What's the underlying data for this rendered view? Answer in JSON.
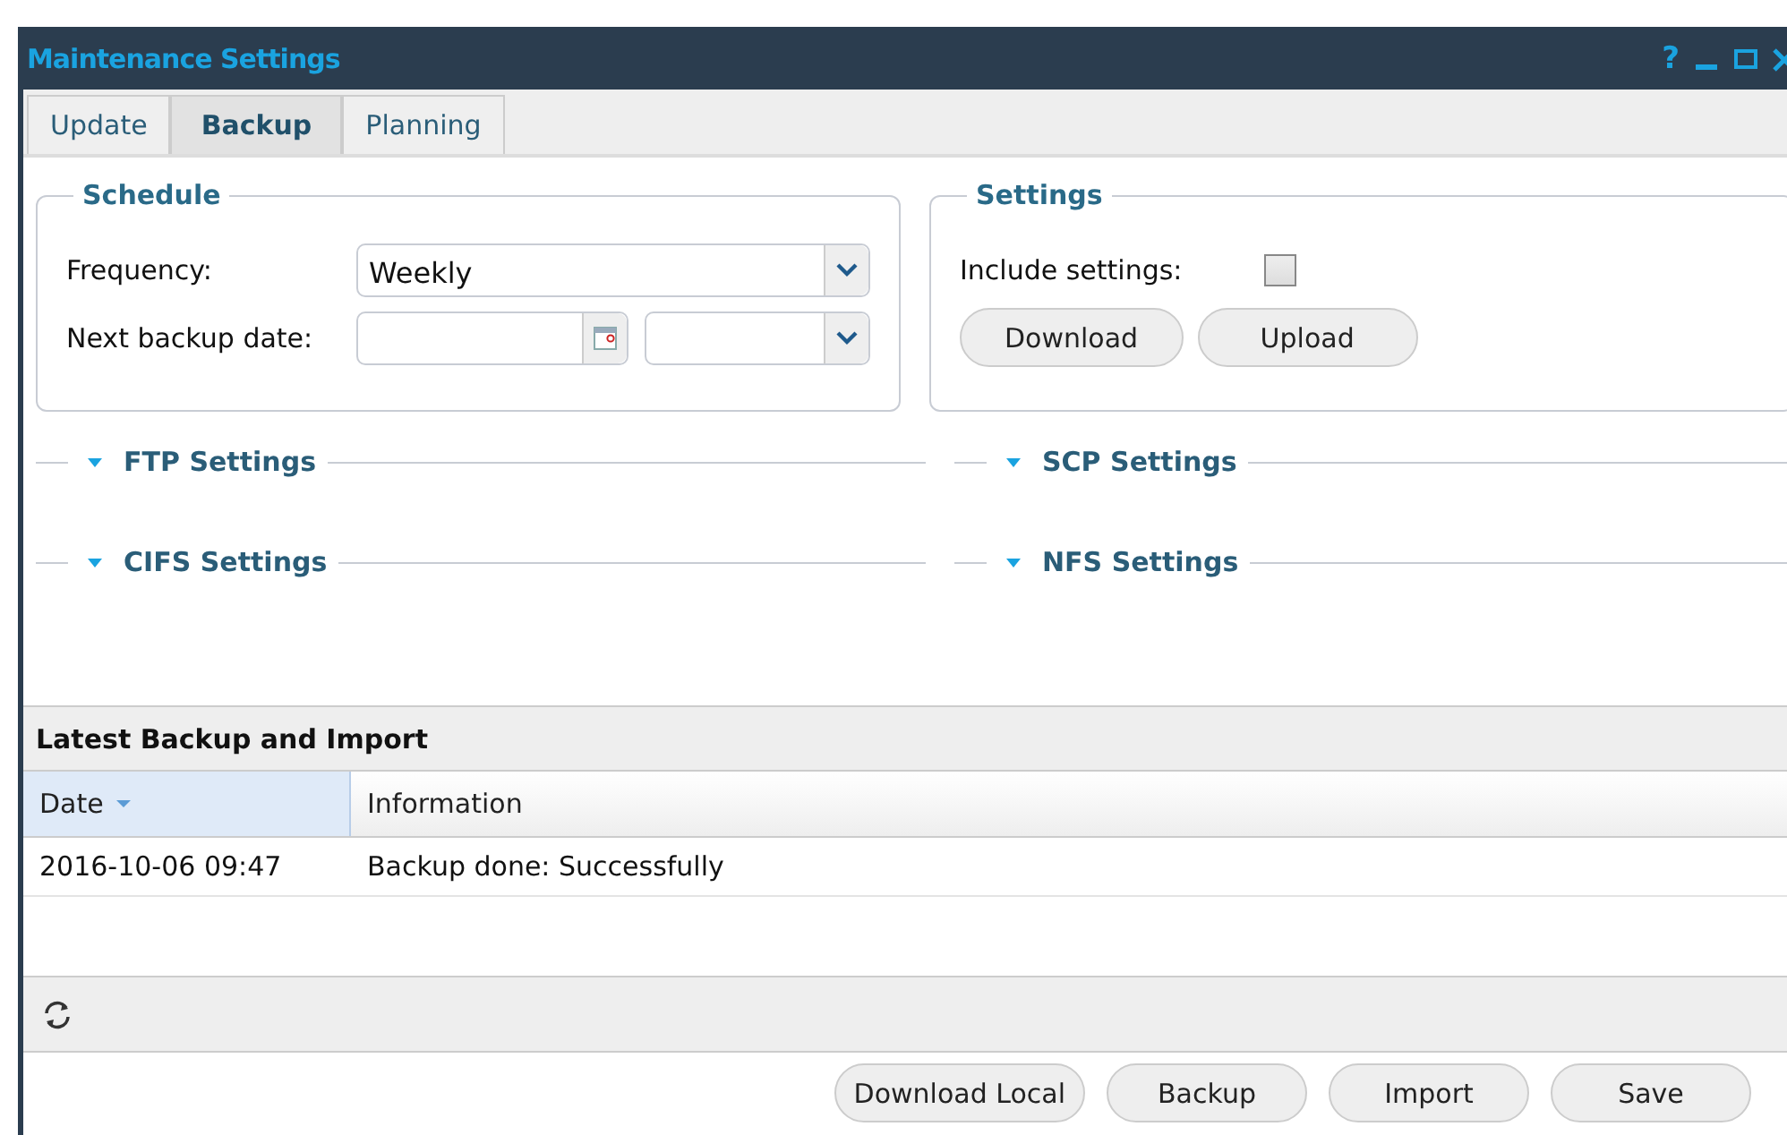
{
  "window": {
    "title": "Maintenance Settings",
    "controls": [
      "?"
    ]
  },
  "tabs": [
    {
      "label": "Update",
      "selected": false
    },
    {
      "label": "Backup",
      "selected": true
    },
    {
      "label": "Planning",
      "selected": false
    }
  ],
  "schedule": {
    "title": "Schedule",
    "frequency": {
      "label": "Frequency:",
      "value": "Weekly"
    },
    "next_backup": {
      "label": "Next backup date:"
    }
  },
  "settings": {
    "title": "Settings",
    "include": {
      "label": "Include settings:",
      "checked": false
    },
    "buttons": [
      "Download",
      "Upload"
    ]
  },
  "sections": [
    {
      "title": "FTP Settings",
      "expanded": false
    },
    {
      "title": "SCP Settings",
      "expanded": false
    },
    {
      "title": "CIFS Settings",
      "expanded": false
    },
    {
      "title": "NFS Settings",
      "expanded": false
    }
  ],
  "grid": {
    "title": "Latest Backup and Import",
    "columns": [
      {
        "label": "Date",
        "sorted": true
      },
      {
        "label": "Information",
        "sorted": false
      }
    ],
    "rows": [
      [
        "2016-10-06 09:47",
        "Backup done: Successfully"
      ]
    ]
  },
  "buttons": [
    "Download Local",
    "Backup",
    "Import",
    "Save"
  ]
}
